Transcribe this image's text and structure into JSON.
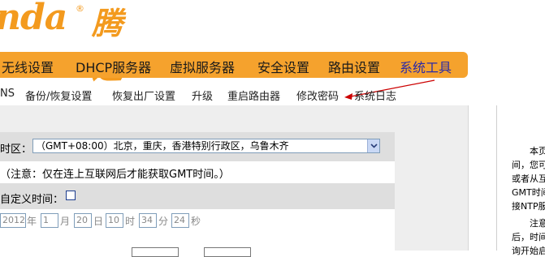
{
  "logo": {
    "latin": "nda",
    "reg": "®",
    "cn": "腾达"
  },
  "nav": {
    "items": [
      {
        "label": "无线设置"
      },
      {
        "label": "DHCP服务器"
      },
      {
        "label": "虚拟服务器"
      },
      {
        "label": "安全设置"
      },
      {
        "label": "路由设置"
      },
      {
        "label": "系统工具"
      }
    ],
    "active_index": 5
  },
  "subnav": {
    "items": [
      {
        "label": "NS"
      },
      {
        "label": "备份/恢复设置"
      },
      {
        "label": "恢复出厂设置"
      },
      {
        "label": "升级"
      },
      {
        "label": "重启路由器"
      },
      {
        "label": "修改密码"
      },
      {
        "label": "系统日志"
      }
    ]
  },
  "time": {
    "timezone_label": "时区：",
    "timezone_value": "（GMT+08:00）北京，重庆，香港特别行政区，乌鲁木齐",
    "note": "（注意：仅在连上互联网后才能获取GMT时间。）",
    "custom_label": "自定义时间：",
    "year": "2012",
    "year_unit": "年",
    "month": "1",
    "month_unit": "月",
    "day": "20",
    "day_unit": "日",
    "hour": "10",
    "hour_unit": "时",
    "minute": "34",
    "minute_unit": "分",
    "second": "24",
    "second_unit": "秒"
  },
  "help": {
    "lines": [
      "本页",
      "间，您可",
      "或者从互",
      "GMT时间",
      "接NTP服",
      "注意",
      "后，时间",
      "询开始启"
    ]
  },
  "colors": {
    "nav_bg": "#f5a22d",
    "brand": "#f39a1e",
    "arrow": "#cc0000"
  }
}
